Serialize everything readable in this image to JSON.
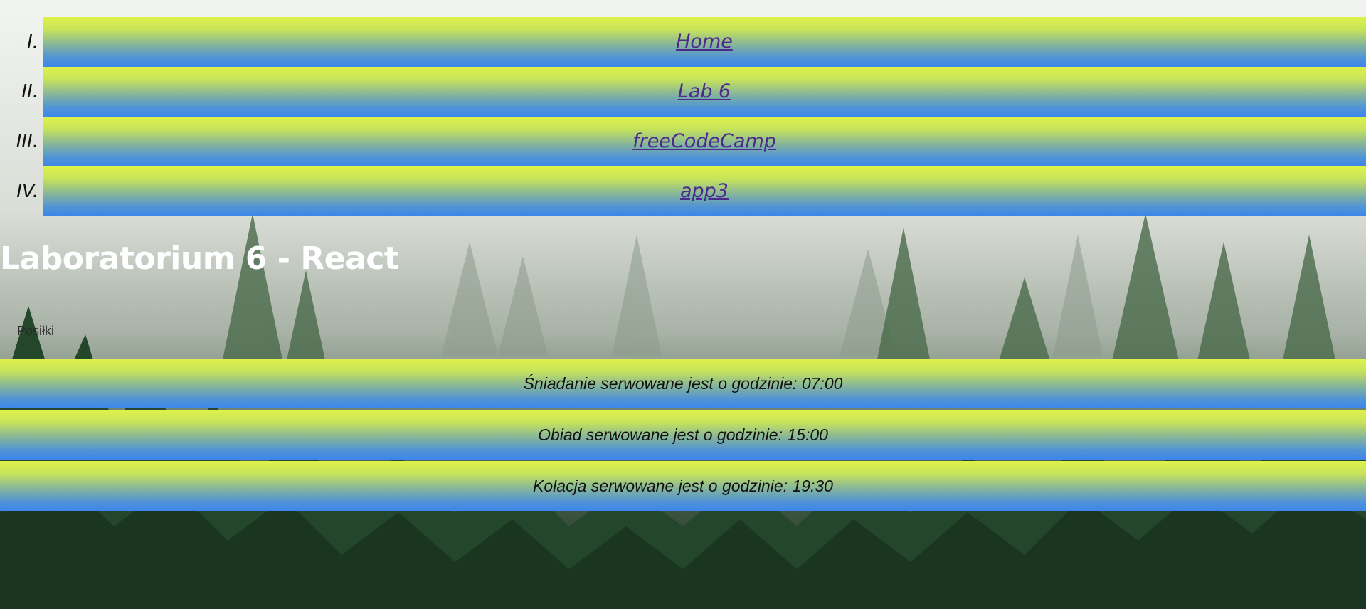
{
  "nav": {
    "items": [
      {
        "num": "I.",
        "label": "Home"
      },
      {
        "num": "II.",
        "label": "Lab 6"
      },
      {
        "num": "III.",
        "label": "freeCodeCamp"
      },
      {
        "num": "IV.",
        "label": "app3"
      }
    ]
  },
  "page": {
    "title": "Laboratorium 6 - React",
    "subtitle": "Posiłki"
  },
  "meals": [
    {
      "text": "Śniadanie serwowane jest o godzinie: 07:00"
    },
    {
      "text": "Obiad serwowane jest o godzinie: 15:00"
    },
    {
      "text": "Kolacja serwowane jest o godzinie: 19:30"
    }
  ],
  "colors": {
    "gradient_top": "#dff24a",
    "gradient_bottom": "#3d86ea",
    "link": "#4b2a8c",
    "title": "#ffffff"
  }
}
